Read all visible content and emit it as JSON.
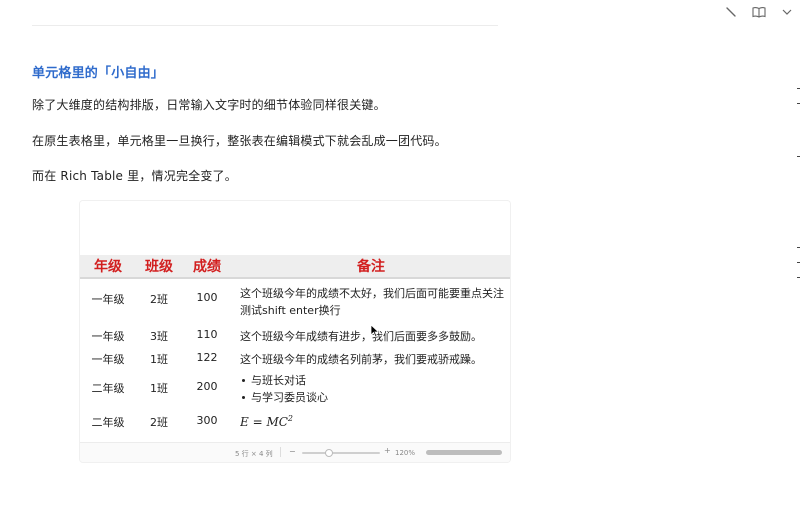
{
  "toolbar": {
    "icons": [
      "edit-icon",
      "book-icon",
      "chevron-down-icon"
    ]
  },
  "content": {
    "section_title": "单元格里的「小自由」",
    "paragraphs": [
      "除了大维度的结构排版，日常输入文字时的细节体验同样很关键。",
      "在原生表格里，单元格里一旦换行，整张表在编辑模式下就会乱成一团代码。",
      "而在 Rich Table 里，情况完全变了。"
    ]
  },
  "table": {
    "headers": [
      "年级",
      "班级",
      "成绩",
      "备注"
    ],
    "header_color": "#d21f1f",
    "rows": [
      {
        "grade": "一年级",
        "class": "2班",
        "score": "100",
        "note_lines": [
          "这个班级今年的成绩不太好，我们后面可能要重点关注",
          "测试shift enter换行"
        ]
      },
      {
        "grade": "一年级",
        "class": "3班",
        "score": "110",
        "note": "这个班级今年成绩有进步，我们后面要多多鼓励。"
      },
      {
        "grade": "一年级",
        "class": "1班",
        "score": "122",
        "note": "这个班级今年的成绩名列前茅，我们要戒骄戒躁。"
      },
      {
        "grade": "二年级",
        "class": "1班",
        "score": "200",
        "note_bullets": [
          "与班长对话",
          "与学习委员谈心"
        ]
      },
      {
        "grade": "二年级",
        "class": "2班",
        "score": "300",
        "formula_base": "E = MC",
        "formula_exp": "2"
      }
    ],
    "footer": {
      "dimensions": "5 行 × 4 列",
      "zoom_out": "−",
      "zoom_in": "+",
      "zoom": "120%",
      "zoom_slider_level": 0.35
    }
  },
  "accent_color": "#2f6bcc"
}
